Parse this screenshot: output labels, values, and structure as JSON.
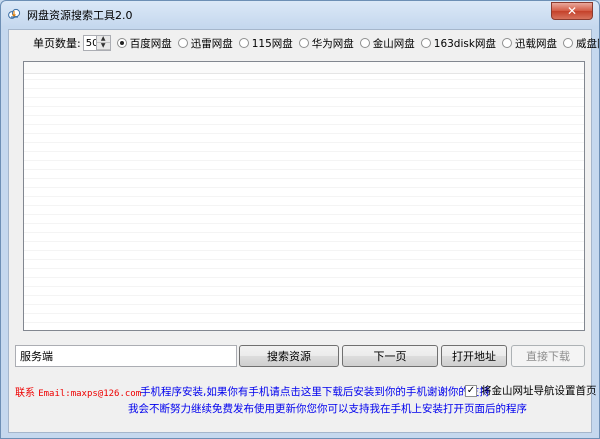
{
  "window": {
    "title": "网盘资源搜索工具2.0",
    "close_glyph": "✕",
    "app_icon": "cloud-icon"
  },
  "toolbar": {
    "per_page_label": "单页数量:",
    "per_page_value": "50",
    "spin_up": "▲",
    "spin_down": "▼",
    "providers": [
      {
        "label": "百度网盘",
        "selected": true
      },
      {
        "label": "迅雷网盘",
        "selected": false
      },
      {
        "label": "115网盘",
        "selected": false
      },
      {
        "label": "华为网盘",
        "selected": false
      },
      {
        "label": "金山网盘",
        "selected": false
      },
      {
        "label": "163disk网盘",
        "selected": false
      },
      {
        "label": "迅载网盘",
        "selected": false
      },
      {
        "label": "威盘网盘",
        "selected": false
      }
    ]
  },
  "actions": {
    "server_value": "服务端",
    "search_label": "搜索资源",
    "next_label": "下一页",
    "open_label": "打开地址",
    "download_label": "直接下载"
  },
  "footer": {
    "contact_label": "联系 ",
    "contact_email": "Email:maxps@126.com",
    "install_tip": "手机程序安装,如果你有手机请点击这里下载后安装到你的手机谢谢你的支持",
    "homepage_label": "将金山网址导航设置首页",
    "homepage_checked": true,
    "check_glyph": "✓",
    "update_tip": "我会不断努力继续免费发布使用更新你您你可以支持我在手机上安装打开页面后的程序"
  },
  "colors": {
    "accent_red": "#e00000",
    "link_blue": "#0000ee",
    "close_red": "#c4412a"
  }
}
